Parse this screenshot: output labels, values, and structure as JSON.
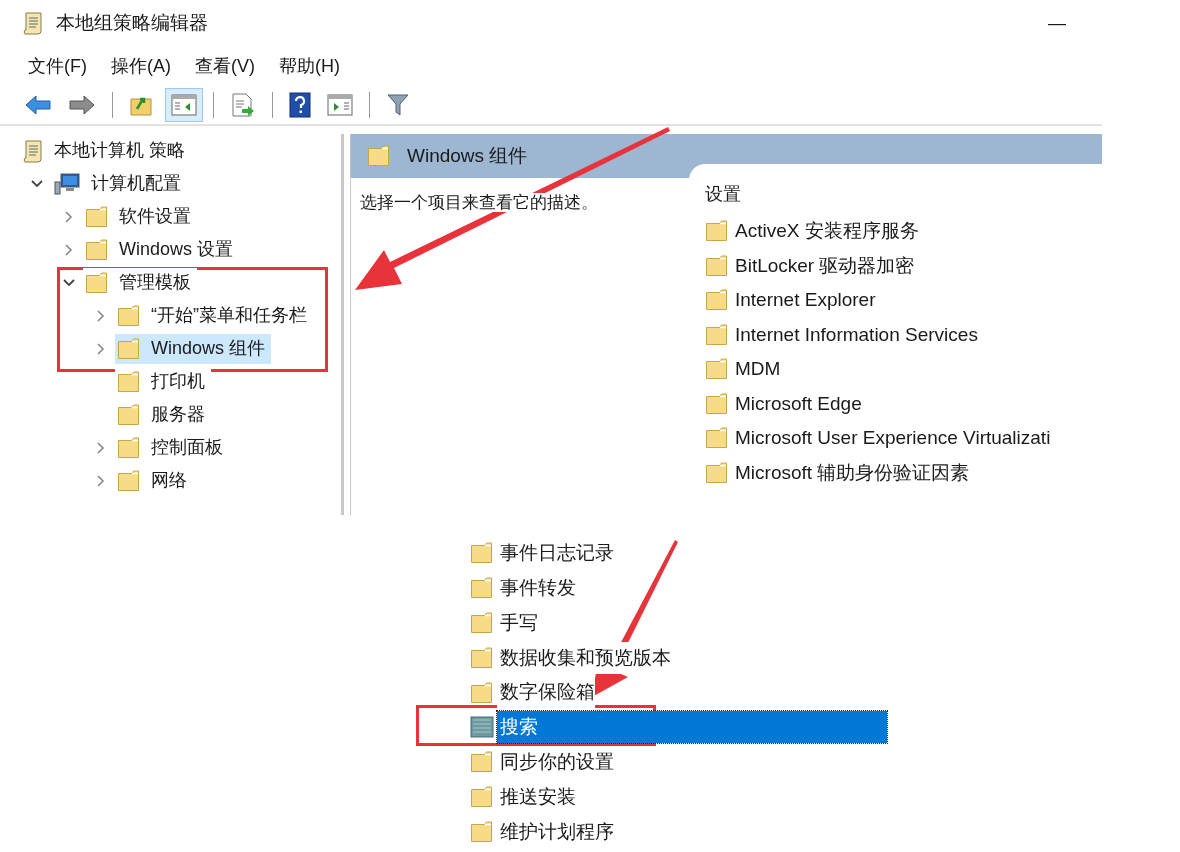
{
  "window": {
    "title": "本地组策略编辑器",
    "minimize": "—"
  },
  "menu": [
    "文件(F)",
    "操作(A)",
    "查看(V)",
    "帮助(H)"
  ],
  "toolbar": [
    {
      "kind": "back",
      "pressed": false
    },
    {
      "kind": "forward",
      "pressed": false
    },
    {
      "kind": "separator"
    },
    {
      "kind": "up",
      "pressed": false
    },
    {
      "kind": "tree",
      "pressed": true
    },
    {
      "kind": "separator"
    },
    {
      "kind": "export",
      "pressed": false
    },
    {
      "kind": "separator"
    },
    {
      "kind": "help",
      "pressed": false
    },
    {
      "kind": "action",
      "pressed": false
    },
    {
      "kind": "separator"
    },
    {
      "kind": "filter",
      "pressed": false
    }
  ],
  "tree": {
    "label": "本地计算机 策略",
    "kind": "policy",
    "selected": false,
    "children": [
      {
        "label": "计算机配置",
        "kind": "computer",
        "expanded": true,
        "selected": false,
        "children": [
          {
            "label": "软件设置",
            "kind": "folder",
            "expanded": false,
            "selected": false
          },
          {
            "label": "Windows 设置",
            "kind": "folder",
            "expanded": false,
            "selected": false
          },
          {
            "label": "管理模板",
            "kind": "folder",
            "expanded": true,
            "selected": false,
            "children": [
              {
                "label": "“开始”菜单和任务栏",
                "kind": "folder",
                "expanded": false,
                "selected": false
              },
              {
                "label": "Windows 组件",
                "kind": "folder",
                "expanded": false,
                "selected": true
              },
              {
                "label": "打印机",
                "kind": "folder",
                "selected": false
              },
              {
                "label": "服务器",
                "kind": "folder",
                "selected": false
              },
              {
                "label": "控制面板",
                "kind": "folder",
                "expanded": false,
                "selected": false
              },
              {
                "label": "网络",
                "kind": "folder",
                "expanded": false,
                "selected": false
              }
            ]
          }
        ]
      }
    ]
  },
  "details": {
    "header": "Windows 组件",
    "description": "选择一个项目来查看它的描述。",
    "column": "设置",
    "items": [
      "ActiveX 安装程序服务",
      "BitLocker 驱动器加密",
      "Internet Explorer",
      "Internet Information Services",
      "MDM",
      "Microsoft Edge",
      "Microsoft User Experience Virtualizati",
      "Microsoft 辅助身份验证因素"
    ]
  },
  "lower_list": [
    {
      "label": "事件日志记录",
      "selected": false
    },
    {
      "label": "事件转发",
      "selected": false
    },
    {
      "label": "手写",
      "selected": false
    },
    {
      "label": "数据收集和预览版本",
      "selected": false
    },
    {
      "label": "数字保险箱",
      "selected": false
    },
    {
      "label": "搜索",
      "selected": true
    },
    {
      "label": "同步你的设置",
      "selected": false
    },
    {
      "label": "推送安装",
      "selected": false
    },
    {
      "label": "维护计划程序",
      "selected": false
    }
  ]
}
